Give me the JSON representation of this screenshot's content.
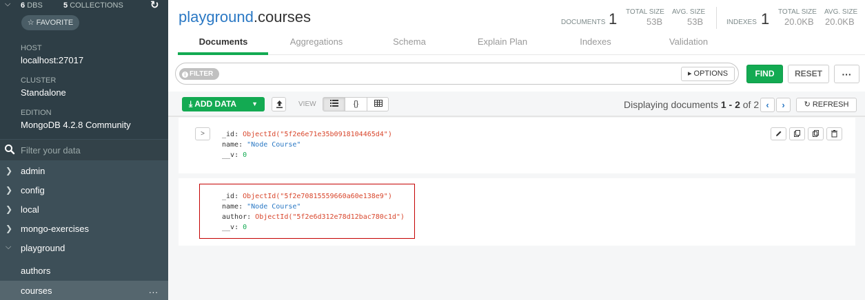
{
  "sidebar": {
    "db_count": "6",
    "db_label": "DBS",
    "coll_count": "5",
    "coll_label": "COLLECTIONS",
    "favorite_label": "☆ FAVORITE",
    "host_label": "HOST",
    "host_value": "localhost:27017",
    "cluster_label": "CLUSTER",
    "cluster_value": "Standalone",
    "edition_label": "EDITION",
    "edition_value": "MongoDB 4.2.8 Community",
    "filter_placeholder": "Filter your data",
    "databases": [
      {
        "name": "admin",
        "expanded": false
      },
      {
        "name": "config",
        "expanded": false
      },
      {
        "name": "local",
        "expanded": false
      },
      {
        "name": "mongo-exercises",
        "expanded": false
      },
      {
        "name": "playground",
        "expanded": true
      }
    ],
    "collections": [
      {
        "name": "authors",
        "active": false
      },
      {
        "name": "courses",
        "active": true,
        "more": "..."
      }
    ]
  },
  "header": {
    "db_name": "playground",
    "collection_name": ".courses",
    "documents_label": "DOCUMENTS",
    "documents_count": "1",
    "total_size_label": "TOTAL SIZE",
    "total_size_value": "53B",
    "avg_size_label": "AVG. SIZE",
    "avg_size_value": "53B",
    "indexes_label": "INDEXES",
    "indexes_count": "1",
    "idx_total_size_label": "TOTAL SIZE",
    "idx_total_size_value": "20.0KB",
    "idx_avg_size_label": "AVG. SIZE",
    "idx_avg_size_value": "20.0KB"
  },
  "tabs": [
    "Documents",
    "Aggregations",
    "Schema",
    "Explain Plan",
    "Indexes",
    "Validation"
  ],
  "query": {
    "filter_label": "FILTER",
    "options_label": "▸ OPTIONS",
    "find_label": "FIND",
    "reset_label": "RESET",
    "more_label": "···"
  },
  "toolbar": {
    "add_data_label": "ADD DATA",
    "view_label": "VIEW",
    "displaying_prefix": "Displaying documents ",
    "range": "1 - 2",
    "of_text": " of ",
    "total": "2",
    "refresh_label": "REFRESH"
  },
  "documents": [
    {
      "fields": [
        {
          "key": "_id",
          "value": "ObjectId(\"5f2e6e71e35b0918104465d4\")",
          "type": "oid"
        },
        {
          "key": "name",
          "value": "\"Node Course\"",
          "type": "str"
        },
        {
          "key": "__v",
          "value": "0",
          "type": "num"
        }
      ]
    },
    {
      "fields": [
        {
          "key": "_id",
          "value": "ObjectId(\"5f2e70815559660a60e138e9\")",
          "type": "oid"
        },
        {
          "key": "name",
          "value": "\"Node Course\"",
          "type": "str"
        },
        {
          "key": "author",
          "value": "ObjectId(\"5f2e6d312e78d12bac780c1d\")",
          "type": "oid"
        },
        {
          "key": "__v",
          "value": "0",
          "type": "num"
        }
      ]
    }
  ],
  "colors": {
    "accent_green": "#13aa52",
    "link_blue": "#2a78c4",
    "sidebar_bg": "#3d4f58",
    "highlight_red": "#c40000"
  }
}
